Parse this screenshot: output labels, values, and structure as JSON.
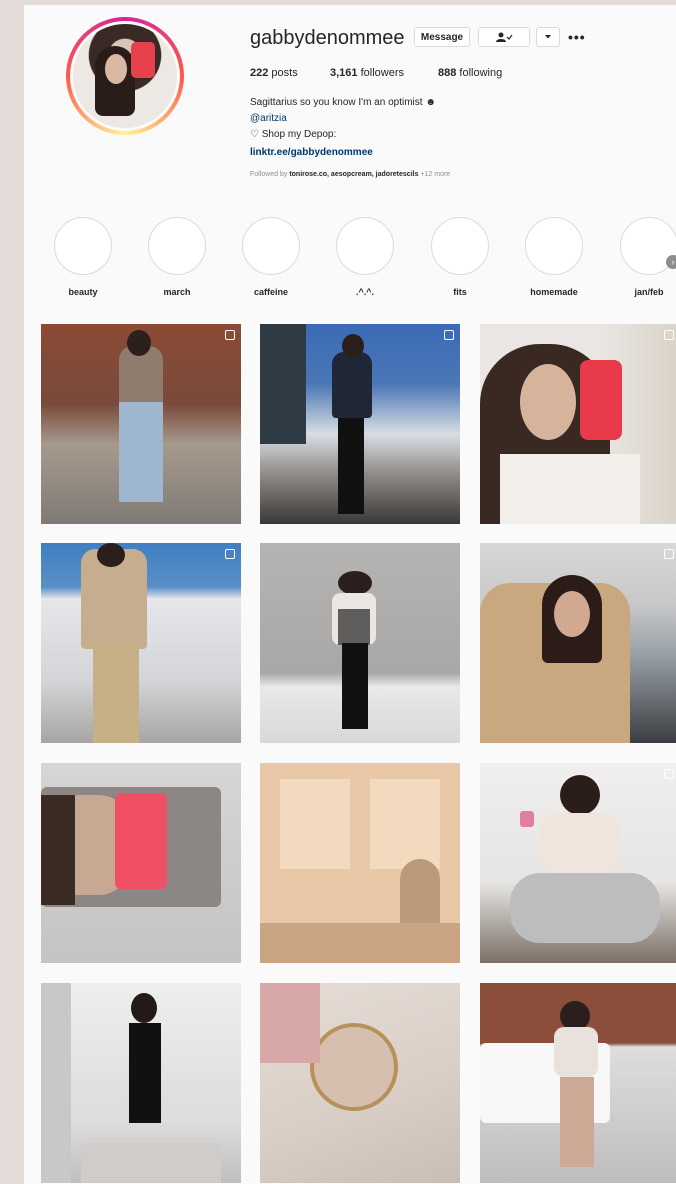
{
  "profile": {
    "username": "gabbydenommee",
    "message_label": "Message",
    "follow_icon": "person-check-icon",
    "dropdown_icon": "chevron-down-icon",
    "more_icon": "more-horizontal-icon"
  },
  "stats": {
    "posts_count": "222",
    "posts_label": "posts",
    "followers_count": "3,161",
    "followers_label": "followers",
    "following_count": "888",
    "following_label": "following"
  },
  "bio": {
    "line1": "Sagittarius so you know I'm an optimist ☻",
    "line2": "@aritzia",
    "line3": "♡ Shop my Depop:",
    "link": "linktr.ee/gabbydenommee",
    "followed_by_prefix": "Followed by",
    "followed_by_names": "tonirose.co, aesopcream, jadoretescils",
    "followed_by_more": "+12 more"
  },
  "highlights": [
    {
      "label": "beauty"
    },
    {
      "label": "march"
    },
    {
      "label": "caffeine"
    },
    {
      "label": ".^.^."
    },
    {
      "label": "fits"
    },
    {
      "label": "homemade"
    },
    {
      "label": "jan/feb"
    }
  ],
  "colors": {
    "link": "#00376b",
    "text": "#262626",
    "muted": "#8e8e8e",
    "background": "#fafafa"
  }
}
